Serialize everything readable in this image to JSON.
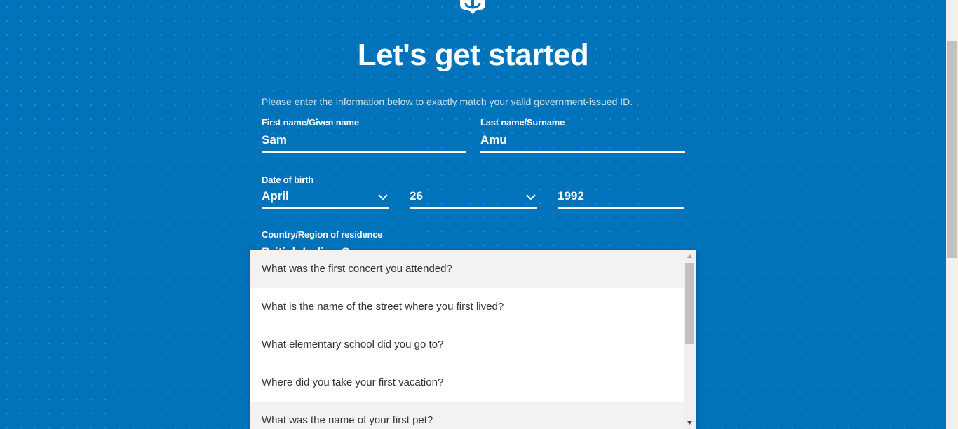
{
  "header": {
    "logo_icon": "anchor-crown-logo",
    "title": "Let's get started",
    "intro": "Please enter the information below to exactly match your valid government-issued ID."
  },
  "form": {
    "first_name": {
      "label": "First name/Given name",
      "value": "Sam"
    },
    "last_name": {
      "label": "Last name/Surname",
      "value": "Amu"
    },
    "dob": {
      "label": "Date of birth",
      "month": "April",
      "day": "26",
      "year": "1992"
    },
    "country": {
      "label": "Country/Region of residence",
      "value": "British Indian Ocean"
    }
  },
  "security_question_dropdown": {
    "options": [
      "What was the first concert you attended?",
      "What is the name of the street where you first lived?",
      "What elementary school did you go to?",
      "Where did you take your first vacation?",
      "What was the name of your first pet?"
    ]
  },
  "colors": {
    "background": "#0073bb",
    "text_on_background": "#ffffff",
    "option_highlight": "#f2f2f2"
  }
}
